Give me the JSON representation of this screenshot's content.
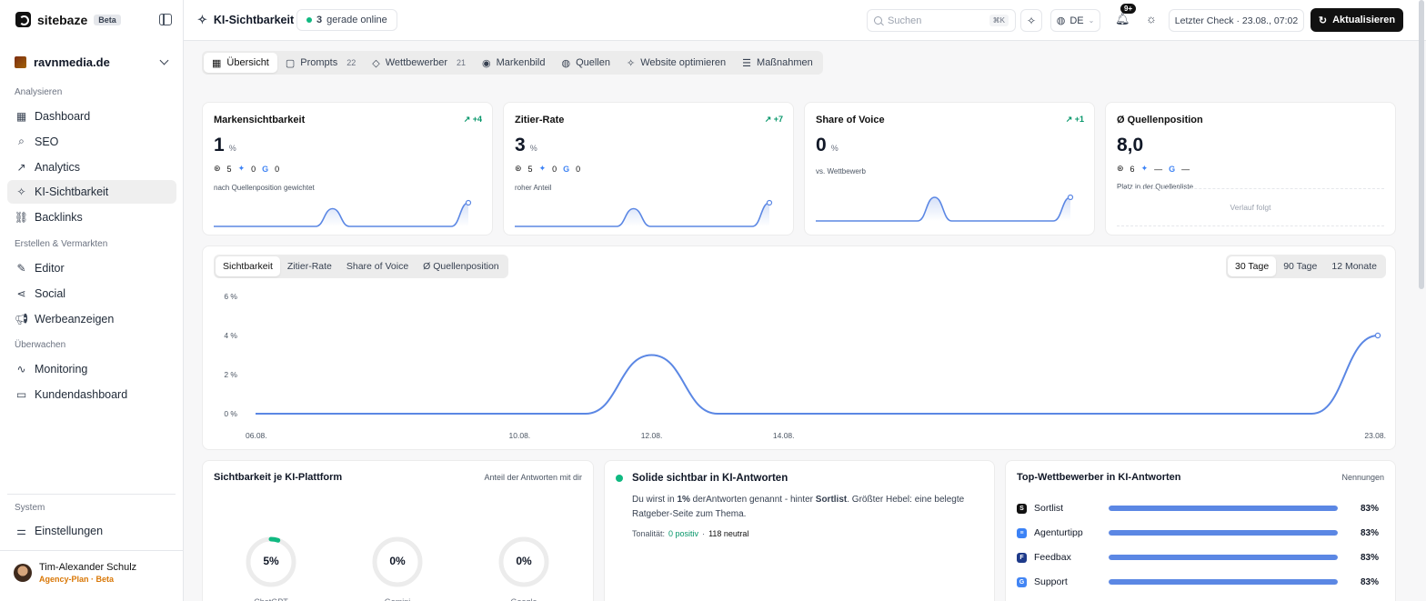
{
  "brand": {
    "name": "sitebaze",
    "badge": "Beta"
  },
  "workspace": {
    "name": "ravnmedia.de"
  },
  "sidebar": {
    "sections": [
      {
        "label": "Analysieren",
        "items": [
          {
            "label": "Dashboard",
            "icon": "grid-icon"
          },
          {
            "label": "SEO",
            "icon": "search-icon"
          },
          {
            "label": "Analytics",
            "icon": "trend-icon"
          },
          {
            "label": "KI-Sichtbarkeit",
            "icon": "sparkle-icon",
            "active": true
          },
          {
            "label": "Backlinks",
            "icon": "link-icon"
          }
        ]
      },
      {
        "label": "Erstellen & Vermarkten",
        "items": [
          {
            "label": "Editor",
            "icon": "edit-icon"
          },
          {
            "label": "Social",
            "icon": "share-icon"
          },
          {
            "label": "Werbeanzeigen",
            "icon": "megaphone-icon"
          }
        ]
      },
      {
        "label": "Überwachen",
        "items": [
          {
            "label": "Monitoring",
            "icon": "pulse-icon"
          },
          {
            "label": "Kundendashboard",
            "icon": "window-icon"
          }
        ]
      }
    ],
    "system_label": "System",
    "settings_label": "Einstellungen",
    "user": {
      "name": "Tim-Alexander Schulz",
      "plan": "Agency-Plan · Beta"
    }
  },
  "topbar": {
    "title": "KI-Sichtbarkeit",
    "online_count": "3",
    "online_text": "gerade online",
    "search_placeholder": "Suchen",
    "search_kbd": "⌘K",
    "lang": "DE",
    "notif_badge": "9+",
    "last_check": "Letzter Check · 23.08., 07:02",
    "refresh_label": "Aktualisieren"
  },
  "tabs": [
    {
      "label": "Übersicht",
      "active": true,
      "count": ""
    },
    {
      "label": "Prompts",
      "count": "22"
    },
    {
      "label": "Wettbewerber",
      "count": "21"
    },
    {
      "label": "Markenbild",
      "count": ""
    },
    {
      "label": "Quellen",
      "count": ""
    },
    {
      "label": "Website optimieren",
      "count": ""
    },
    {
      "label": "Maßnahmen",
      "count": ""
    }
  ],
  "kpis": [
    {
      "title": "Markensichtbarkeit",
      "delta": "↗ +4",
      "value": "1",
      "unit": "%",
      "chatgpt": "5",
      "gemini": "0",
      "google": "0",
      "sub": "nach Quellenposition gewichtet",
      "spark": [
        0,
        0,
        0,
        0,
        0,
        0,
        0,
        3,
        0,
        0,
        0,
        0,
        0,
        0,
        0,
        4
      ]
    },
    {
      "title": "Zitier-Rate",
      "delta": "↗ +7",
      "value": "3",
      "unit": "%",
      "chatgpt": "5",
      "gemini": "0",
      "google": "0",
      "sub": "roher Anteil",
      "spark": [
        0,
        0,
        0,
        0,
        0,
        0,
        0,
        3,
        0,
        0,
        0,
        0,
        0,
        0,
        0,
        4
      ]
    },
    {
      "title": "Share of Voice",
      "delta": "↗ +1",
      "value": "0",
      "unit": "%",
      "chatgpt": "",
      "gemini": "",
      "google": "",
      "sub": "vs. Wettbewerb",
      "spark": [
        0,
        0,
        0,
        0,
        0,
        0,
        0,
        4,
        0,
        0,
        0,
        0,
        0,
        0,
        0,
        4
      ]
    },
    {
      "title": "Ø Quellenposition",
      "delta": "",
      "value": "8,0",
      "unit": "",
      "chatgpt": "6",
      "gemini": "—",
      "google": "—",
      "sub": "Platz in der Quellenliste",
      "pending": "Verlauf folgt"
    }
  ],
  "chart_tabs": [
    "Sichtbarkeit",
    "Zitier-Rate",
    "Share of Voice",
    "Ø Quellenposition"
  ],
  "range_tabs": [
    "30 Tage",
    "90 Tage",
    "12 Monate"
  ],
  "chart_data": {
    "type": "line",
    "title": "",
    "x": [
      "06.08.",
      "07.08.",
      "08.08.",
      "09.08.",
      "10.08.",
      "11.08.",
      "12.08.",
      "13.08.",
      "14.08.",
      "15.08.",
      "16.08.",
      "17.08.",
      "18.08.",
      "19.08.",
      "20.08.",
      "21.08.",
      "22.08.",
      "23.08."
    ],
    "x_tick_labels": [
      "06.08.",
      "10.08.",
      "12.08.",
      "14.08.",
      "23.08."
    ],
    "y_tick_labels": [
      "6 %",
      "4 %",
      "2 %",
      "0 %"
    ],
    "series": [
      {
        "values": [
          0,
          0,
          0,
          0,
          0,
          0,
          3,
          0,
          0,
          0,
          0,
          0,
          0,
          0,
          0,
          0,
          0,
          4
        ]
      }
    ],
    "ylim": [
      0,
      6
    ],
    "color": "#5b87e4"
  },
  "platforms": {
    "title": "Sichtbarkeit je KI-Plattform",
    "subtitle": "Anteil der Antworten mit dir",
    "items": [
      {
        "name": "ChatGPT",
        "value": "5%",
        "fraction": 0.05
      },
      {
        "name": "Gemini",
        "value": "0%",
        "fraction": 0
      },
      {
        "name": "Google",
        "value": "0%",
        "fraction": 0
      }
    ]
  },
  "summary": {
    "title": "Solide sichtbar in KI-Antworten",
    "text_a": "Du wirst in ",
    "text_b": "1%",
    "text_c": " derAntworten genannt - hinter ",
    "text_d": "Sortlist",
    "text_e": ". Größter Hebel: eine belegte Ratgeber-Seite zum Thema.",
    "tone_label": "Tonalität:",
    "tone_positive": "0 positiv",
    "tone_sep": "·",
    "tone_neutral": "118 neutral"
  },
  "competitors": {
    "title": "Top-Wettbewerber in KI-Antworten",
    "subtitle": "Nennungen",
    "items": [
      {
        "name": "Sortlist",
        "value": "83%",
        "fraction": 0.83,
        "color": "#111111"
      },
      {
        "name": "Agenturtipp",
        "value": "83%",
        "fraction": 0.83,
        "color": "#3b82f6"
      },
      {
        "name": "Feedbax",
        "value": "83%",
        "fraction": 0.83,
        "color": "#1e3a8a"
      },
      {
        "name": "Support",
        "value": "83%",
        "fraction": 0.83,
        "color": "#4285f4"
      }
    ]
  }
}
